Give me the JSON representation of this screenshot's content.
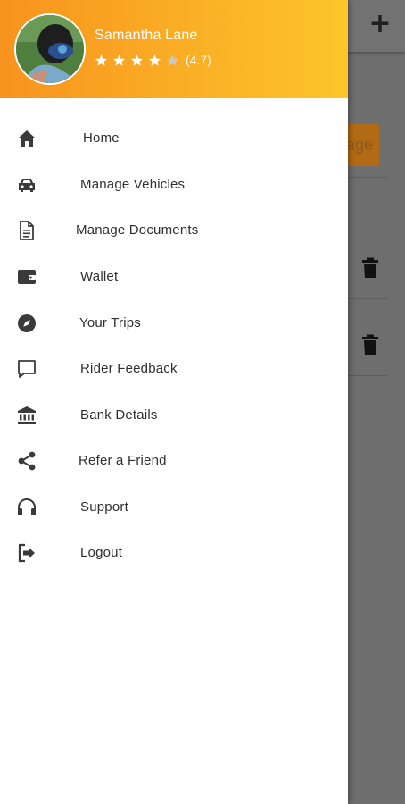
{
  "background": {
    "button_text": "nage",
    "plus_icon": "plus-icon",
    "trash_icon": "trash-icon"
  },
  "profile": {
    "name": "Samantha Lane",
    "rating": 4.7,
    "rating_text": "(4.7)",
    "stars_filled": 4,
    "stars_total": 5
  },
  "menu": {
    "items": [
      {
        "label": "Home",
        "icon": "home-icon"
      },
      {
        "label": "Manage Vehicles",
        "icon": "car-icon"
      },
      {
        "label": "Manage Documents",
        "icon": "document-icon"
      },
      {
        "label": "Wallet",
        "icon": "wallet-icon"
      },
      {
        "label": "Your Trips",
        "icon": "compass-icon"
      },
      {
        "label": "Rider Feedback",
        "icon": "chat-bubble-icon"
      },
      {
        "label": "Bank Details",
        "icon": "bank-icon"
      },
      {
        "label": "Refer a Friend",
        "icon": "share-icon"
      },
      {
        "label": "Support",
        "icon": "headphones-icon"
      },
      {
        "label": "Logout",
        "icon": "logout-icon"
      }
    ]
  },
  "colors": {
    "header_gradient_start": "#f7931e",
    "header_gradient_end": "#fdc52a",
    "icon_color": "#3a3a3a",
    "star_empty": "#b8b8b8"
  }
}
